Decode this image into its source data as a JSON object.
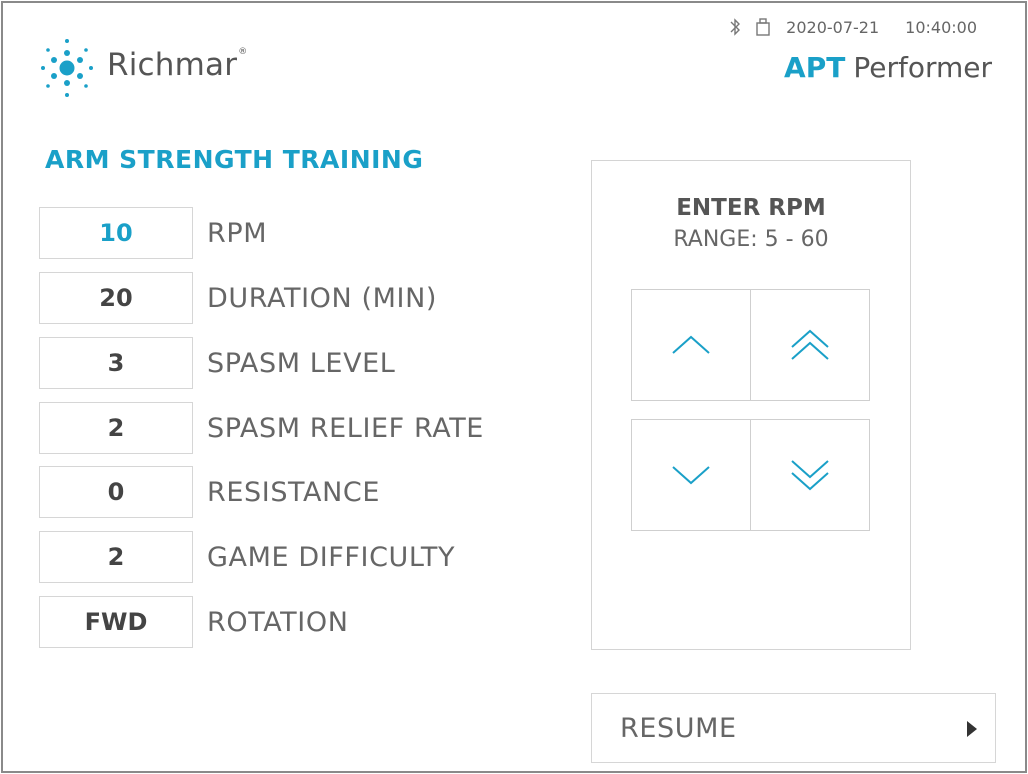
{
  "header": {
    "brand": "Richmar",
    "brand_mark": "®",
    "date": "2020-07-21",
    "time": "10:40:00",
    "product_prefix": "APT",
    "product_name": "Performer"
  },
  "section_title": "ARM STRENGTH TRAINING",
  "parameters": [
    {
      "value": "10",
      "label": "RPM",
      "active": true
    },
    {
      "value": "20",
      "label": "DURATION (MIN)"
    },
    {
      "value": "3",
      "label": "SPASM LEVEL"
    },
    {
      "value": "2",
      "label": "SPASM RELIEF RATE"
    },
    {
      "value": "0",
      "label": "RESISTANCE"
    },
    {
      "value": "2",
      "label": "GAME DIFFICULTY"
    },
    {
      "value": "FWD",
      "label": "ROTATION"
    }
  ],
  "rpm_panel": {
    "title": "ENTER RPM",
    "range": "RANGE: 5 - 60"
  },
  "resume": {
    "label": "RESUME"
  },
  "colors": {
    "accent": "#1aa0c8",
    "text": "#555555",
    "border": "#d6d6d6"
  },
  "icons": {
    "bluetooth": "bluetooth-icon",
    "usb": "usb-icon",
    "increment": "chevron-up-icon",
    "fast_increment": "double-chevron-up-icon",
    "decrement": "chevron-down-icon",
    "fast_decrement": "double-chevron-down-icon",
    "resume": "play-triangle-icon"
  }
}
